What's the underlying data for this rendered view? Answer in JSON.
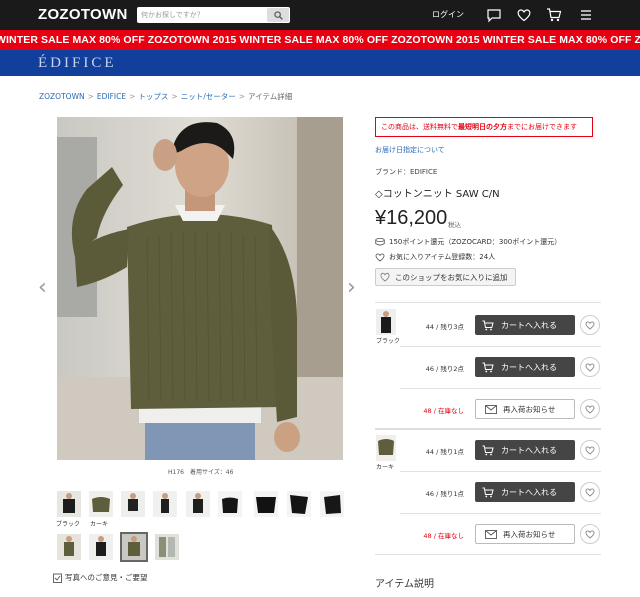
{
  "header": {
    "logo": "ZOZOTOWN",
    "search_placeholder": "何かお探しですか？",
    "login": "ログイン",
    "icons": [
      "search-icon",
      "message-icon",
      "heart-icon",
      "cart-icon",
      "menu-icon"
    ]
  },
  "sale_banner": {
    "text": "WINTER SALE   MAX 80% OFF   ZOZOTOWN 2015 WINTER SALE   MAX 80% OFF   ZOZOTOWN 2015 WINTER SALE   MAX 80% OFF   ZOZOTOWN",
    "color": "#e60012"
  },
  "shop": {
    "name": "ÉDIFICE",
    "color": "#123e9c"
  },
  "breadcrumb": [
    "ZOZOTOWN",
    "EDIFICE",
    "トップス",
    "ニット/セーター",
    "アイテム詳細"
  ],
  "image_caption": "H176　着用サイズ：46",
  "thumbnails": {
    "label_1": "ブラック",
    "label_2": "カーキ"
  },
  "opinion_link": "写真へのご意見・ご要望",
  "product": {
    "notice_prefix": "この商品は、送料無料で",
    "notice_bold": "最短明日の夕方",
    "notice_suffix": "までにお届けできます",
    "delivery_link": "お届け日指定について",
    "brand": "ブランド：EDIFICE",
    "title": "◇コットンニット SAW C/N",
    "price": "¥16,200",
    "tax": "税込",
    "points": "150ポイント還元（ZOZOCARD：300ポイント還元）",
    "favorites": "お気に入りアイテム登録数：24人",
    "shop_fav_button": "このショップをお気に入りに追加"
  },
  "stock": {
    "cart_label": "カートへ入れる",
    "restock_label": "再入荷お知らせ",
    "colors": [
      {
        "name": "ブラック",
        "rows": [
          {
            "size": "44 / 残り3点",
            "status": "in"
          },
          {
            "size": "46 / 残り2点",
            "status": "in"
          },
          {
            "size": "48 / 在庫なし",
            "status": "out"
          }
        ]
      },
      {
        "name": "カーキ",
        "rows": [
          {
            "size": "44 / 残り1点",
            "status": "in"
          },
          {
            "size": "46 / 残り1点",
            "status": "in"
          },
          {
            "size": "48 / 在庫なし",
            "status": "out"
          }
        ]
      }
    ]
  },
  "item_description_heading": "アイテム説明",
  "colors": {
    "red": "#e60012",
    "link": "#2a6ab5",
    "cart_button": "#454545"
  }
}
